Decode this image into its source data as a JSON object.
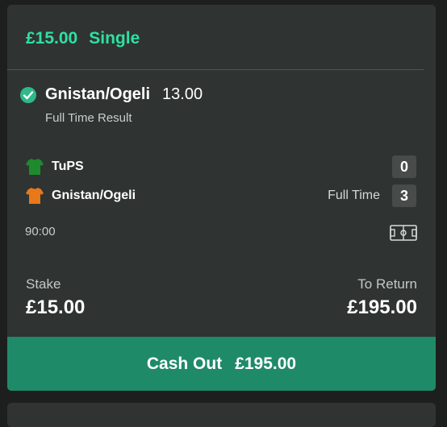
{
  "bet": {
    "amount": "£15.00",
    "type": "Single"
  },
  "selection": {
    "name": "Gnistan/Ogeli",
    "odds": "13.00",
    "market": "Full Time Result",
    "status_icon": "settled-check-icon"
  },
  "match": {
    "home": {
      "name": "TuPS",
      "score": "0",
      "kit_color": "#1e8a2e",
      "icon": "shirt-icon"
    },
    "away": {
      "name": "Gnistan/Ogeli",
      "score": "3",
      "kit_color": "#e8781a",
      "icon": "shirt-icon"
    },
    "period": "Full Time",
    "clock": "90:00",
    "pitch_icon": "pitch-icon"
  },
  "totals": {
    "stake_label": "Stake",
    "stake_value": "£15.00",
    "return_label": "To Return",
    "return_value": "£195.00"
  },
  "cashout": {
    "label": "Cash Out",
    "value": "£195.00",
    "color": "#1f8a68"
  },
  "colors": {
    "accent": "#2fe0a2",
    "card": "#2f3432",
    "background": "#1c1f1e"
  }
}
